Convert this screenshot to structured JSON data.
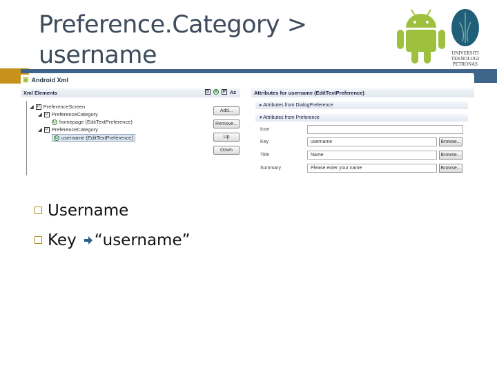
{
  "slide": {
    "title_line1": "Preference.Category >",
    "title_line2": "username",
    "logo_text": [
      "UNIVERSITI",
      "TEKNOLOGI",
      "PETRONAS"
    ]
  },
  "screenshot": {
    "window_title": "Android Xml",
    "left_pane": {
      "header": "Xml Elements",
      "toolbar_icons": [
        "S",
        "A",
        "P",
        "Az"
      ],
      "tree": [
        {
          "label": "PreferenceScreen",
          "icon": "P"
        },
        {
          "label": "PreferenceCategory",
          "icon": "P"
        },
        {
          "label": "homepage (EditTextPreference)",
          "icon": "E"
        },
        {
          "label": "PreferenceCategory",
          "icon": "P"
        },
        {
          "label": "username (EditTextPreference)",
          "icon": "E"
        }
      ],
      "buttons": {
        "add": "Add...",
        "remove": "Remove...",
        "up": "Up",
        "down": "Down"
      }
    },
    "right_pane": {
      "header": "Attributes for username (EditTextPreference)",
      "section1": "Attributes from DialogPreference",
      "section2": "Attributes from Preference",
      "rows": [
        {
          "label": "Icon",
          "value": ""
        },
        {
          "label": "Key",
          "value": "username",
          "browse": "Browse..."
        },
        {
          "label": "Title",
          "value": "Name",
          "browse": "Browse..."
        },
        {
          "label": "Summary",
          "value": "Please enter your name",
          "browse": "Browse..."
        }
      ]
    }
  },
  "bullets": [
    "Username",
    "Key",
    "“username”"
  ]
}
